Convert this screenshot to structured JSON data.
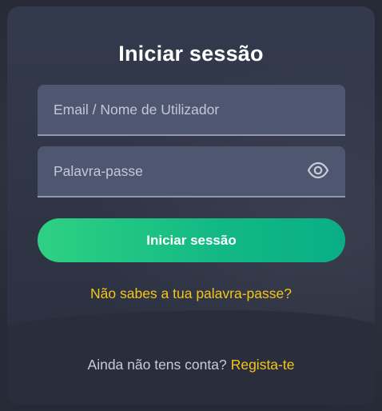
{
  "login": {
    "title": "Iniciar sessão",
    "email_placeholder": "Email / Nome de Utilizador",
    "password_placeholder": "Palavra-passe",
    "submit_label": "Iniciar sessão",
    "forgot_label": "Não sabes a tua palavra-passe?",
    "signup_question": "Ainda não tens conta?",
    "signup_link": "Regista-te"
  },
  "icons": {
    "password_toggle": "eye-icon"
  },
  "colors": {
    "accent_green": "#1cc783",
    "link_yellow": "#f5c518",
    "modal_bg": "#343a4d",
    "field_bg": "#4f5770"
  }
}
